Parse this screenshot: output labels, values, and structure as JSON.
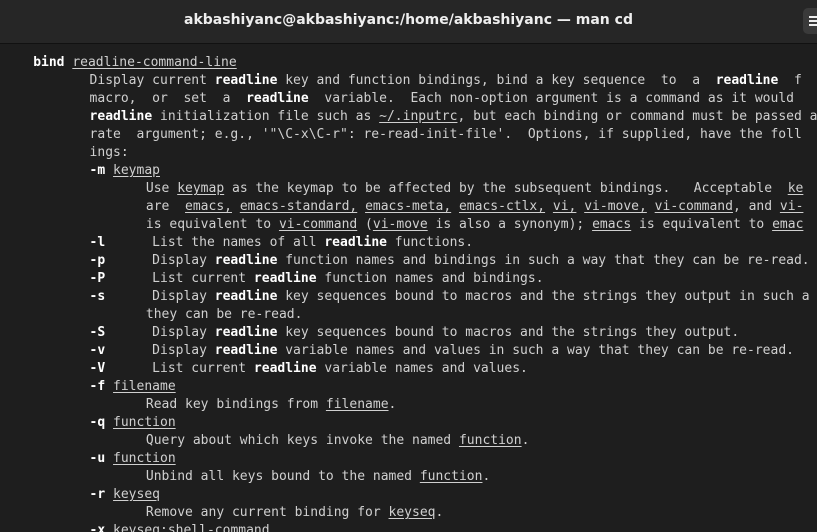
{
  "window": {
    "title": "akbashiyanc@akbashiyanc:/home/akbashiyanc — man cd"
  },
  "colors": {
    "background": "#1e1e1e",
    "titlebar": "#262626",
    "text": "#d0d0d0",
    "bold_text": "#ffffff"
  },
  "lines": [
    {
      "indent": 4,
      "segs": [
        [
          "b",
          "bind"
        ],
        [
          "n",
          " "
        ],
        [
          "u",
          "readline-command-line"
        ]
      ]
    },
    {
      "indent": 11,
      "segs": [
        [
          "n",
          "Display current "
        ],
        [
          "b",
          "readline"
        ],
        [
          "n",
          " key and function bindings, bind a key sequence  to  a  "
        ],
        [
          "b",
          "readline"
        ],
        [
          "n",
          "  f"
        ]
      ]
    },
    {
      "indent": 11,
      "segs": [
        [
          "n",
          "macro,  or  set  a  "
        ],
        [
          "b",
          "readline"
        ],
        [
          "n",
          "  variable.  Each non-option argument is a command as it would"
        ]
      ]
    },
    {
      "indent": 11,
      "segs": [
        [
          "b",
          "readline"
        ],
        [
          "n",
          " initialization file such as "
        ],
        [
          "u",
          "~/.inputrc"
        ],
        [
          "n",
          ", but each binding or command must be passed a"
        ]
      ]
    },
    {
      "indent": 11,
      "segs": [
        [
          "n",
          "rate  argument; e.g., '\"\\C-x\\C-r\": re-read-init-file'.  Options, if supplied, have the foll"
        ]
      ]
    },
    {
      "indent": 11,
      "segs": [
        [
          "n",
          "ings:"
        ]
      ]
    },
    {
      "indent": 11,
      "segs": [
        [
          "b",
          "-m"
        ],
        [
          "n",
          " "
        ],
        [
          "u",
          "keymap"
        ]
      ]
    },
    {
      "indent": 18,
      "segs": [
        [
          "n",
          "Use "
        ],
        [
          "u",
          "keymap"
        ],
        [
          "n",
          " as the keymap to be affected by the subsequent bindings.   Acceptable  "
        ],
        [
          "u",
          "ke"
        ]
      ]
    },
    {
      "indent": 18,
      "segs": [
        [
          "n",
          "are  "
        ],
        [
          "u",
          "emacs,"
        ],
        [
          "n",
          " "
        ],
        [
          "u",
          "emacs-standard,"
        ],
        [
          "n",
          " "
        ],
        [
          "u",
          "emacs-meta,"
        ],
        [
          "n",
          " "
        ],
        [
          "u",
          "emacs-ctlx,"
        ],
        [
          "n",
          " "
        ],
        [
          "u",
          "vi,"
        ],
        [
          "n",
          " "
        ],
        [
          "u",
          "vi-move,"
        ],
        [
          "n",
          " "
        ],
        [
          "u",
          "vi-command"
        ],
        [
          "n",
          ", and "
        ],
        [
          "u",
          "vi-"
        ]
      ]
    },
    {
      "indent": 18,
      "segs": [
        [
          "n",
          "is equivalent to "
        ],
        [
          "u",
          "vi-command"
        ],
        [
          "n",
          " ("
        ],
        [
          "u",
          "vi-move"
        ],
        [
          "n",
          " is also a synonym); "
        ],
        [
          "u",
          "emacs"
        ],
        [
          "n",
          " is equivalent to "
        ],
        [
          "u",
          "emac"
        ]
      ]
    },
    {
      "indent": 11,
      "segs": [
        [
          "b",
          "-l"
        ],
        [
          "n",
          "      List the names of all "
        ],
        [
          "b",
          "readline"
        ],
        [
          "n",
          " functions."
        ]
      ]
    },
    {
      "indent": 11,
      "segs": [
        [
          "b",
          "-p"
        ],
        [
          "n",
          "      Display "
        ],
        [
          "b",
          "readline"
        ],
        [
          "n",
          " function names and bindings in such a way that they can be re-read."
        ]
      ]
    },
    {
      "indent": 11,
      "segs": [
        [
          "b",
          "-P"
        ],
        [
          "n",
          "      List current "
        ],
        [
          "b",
          "readline"
        ],
        [
          "n",
          " function names and bindings."
        ]
      ]
    },
    {
      "indent": 11,
      "segs": [
        [
          "b",
          "-s"
        ],
        [
          "n",
          "      Display "
        ],
        [
          "b",
          "readline"
        ],
        [
          "n",
          " key sequences bound to macros and the strings they output in such a"
        ]
      ]
    },
    {
      "indent": 18,
      "segs": [
        [
          "n",
          "they can be re-read."
        ]
      ]
    },
    {
      "indent": 11,
      "segs": [
        [
          "b",
          "-S"
        ],
        [
          "n",
          "      Display "
        ],
        [
          "b",
          "readline"
        ],
        [
          "n",
          " key sequences bound to macros and the strings they output."
        ]
      ]
    },
    {
      "indent": 11,
      "segs": [
        [
          "b",
          "-v"
        ],
        [
          "n",
          "      Display "
        ],
        [
          "b",
          "readline"
        ],
        [
          "n",
          " variable names and values in such a way that they can be re-read."
        ]
      ]
    },
    {
      "indent": 11,
      "segs": [
        [
          "b",
          "-V"
        ],
        [
          "n",
          "      List current "
        ],
        [
          "b",
          "readline"
        ],
        [
          "n",
          " variable names and values."
        ]
      ]
    },
    {
      "indent": 11,
      "segs": [
        [
          "b",
          "-f"
        ],
        [
          "n",
          " "
        ],
        [
          "u",
          "filename"
        ]
      ]
    },
    {
      "indent": 18,
      "segs": [
        [
          "n",
          "Read key bindings from "
        ],
        [
          "u",
          "filename"
        ],
        [
          "n",
          "."
        ]
      ]
    },
    {
      "indent": 11,
      "segs": [
        [
          "b",
          "-q"
        ],
        [
          "n",
          " "
        ],
        [
          "u",
          "function"
        ]
      ]
    },
    {
      "indent": 18,
      "segs": [
        [
          "n",
          "Query about which keys invoke the named "
        ],
        [
          "u",
          "function"
        ],
        [
          "n",
          "."
        ]
      ]
    },
    {
      "indent": 11,
      "segs": [
        [
          "b",
          "-u"
        ],
        [
          "n",
          " "
        ],
        [
          "u",
          "function"
        ]
      ]
    },
    {
      "indent": 18,
      "segs": [
        [
          "n",
          "Unbind all keys bound to the named "
        ],
        [
          "u",
          "function"
        ],
        [
          "n",
          "."
        ]
      ]
    },
    {
      "indent": 11,
      "segs": [
        [
          "b",
          "-r"
        ],
        [
          "n",
          " "
        ],
        [
          "u",
          "keyseq"
        ]
      ]
    },
    {
      "indent": 18,
      "segs": [
        [
          "n",
          "Remove any current binding for "
        ],
        [
          "u",
          "keyseq"
        ],
        [
          "n",
          "."
        ]
      ]
    },
    {
      "indent": 11,
      "segs": [
        [
          "b",
          "-x"
        ],
        [
          "n",
          " "
        ],
        [
          "u",
          "keyseq"
        ],
        [
          "n",
          ":"
        ],
        [
          "u",
          "shell-command"
        ]
      ]
    }
  ]
}
